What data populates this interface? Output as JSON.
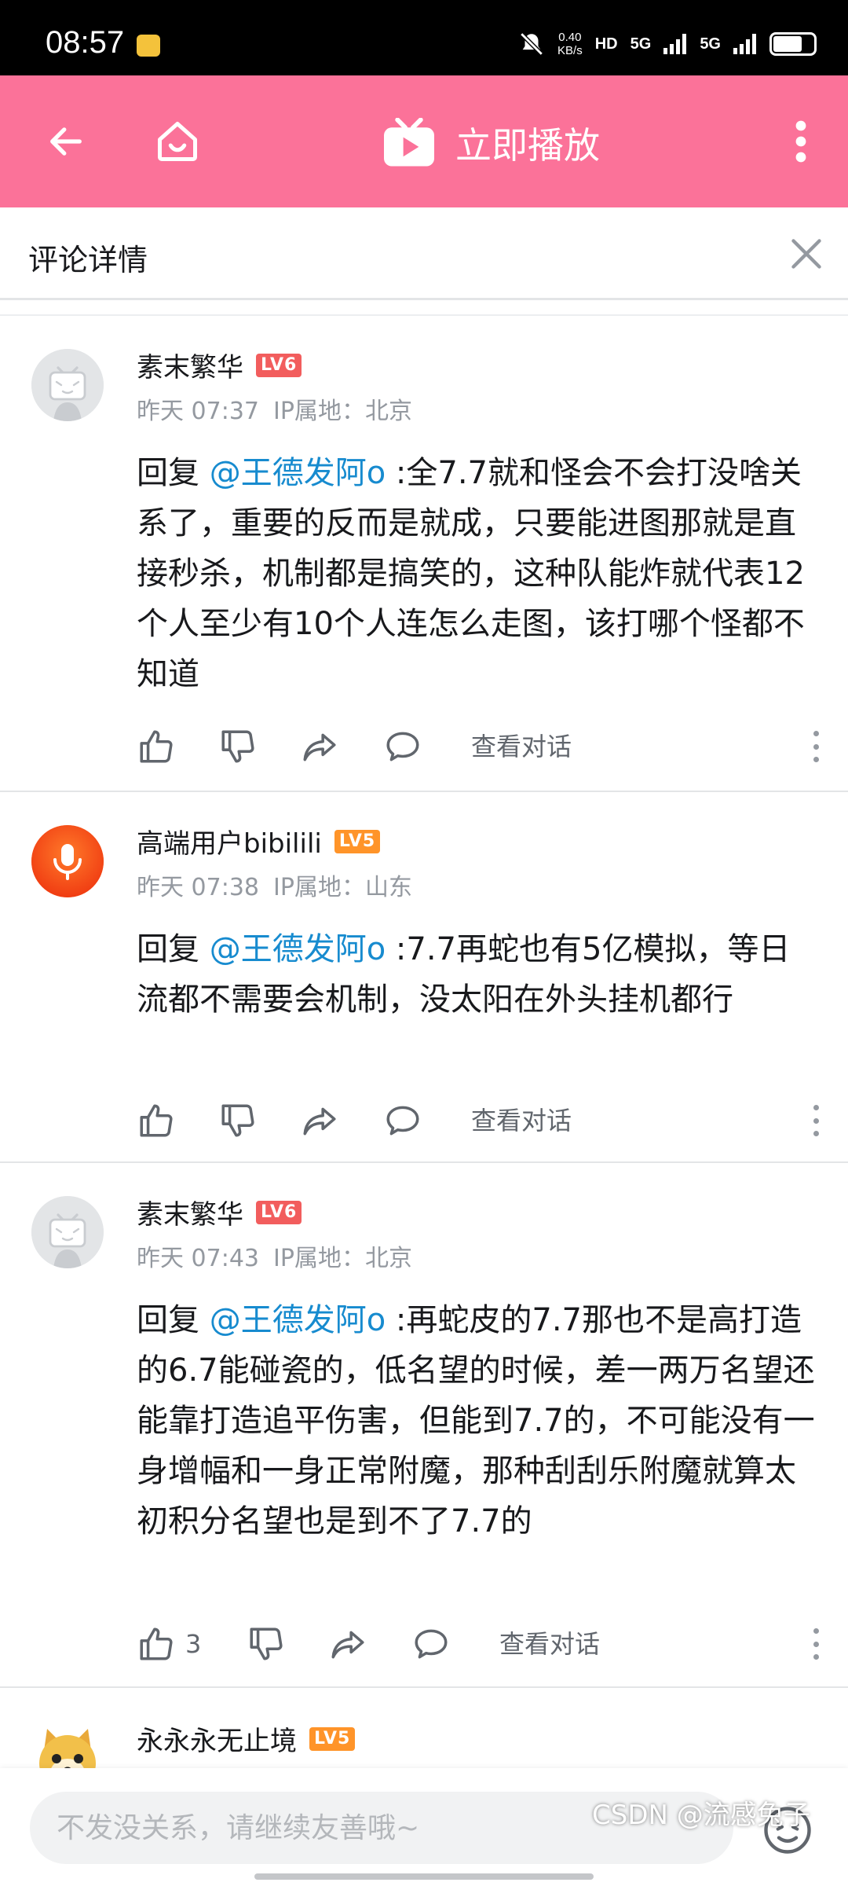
{
  "status_bar": {
    "time": "08:57",
    "net_speed_value": "0.40",
    "net_speed_unit": "KB/s",
    "hd_label": "HD",
    "signal1": "5G",
    "signal2": "5G",
    "battery_level": 0.66
  },
  "header": {
    "play_label": "立即播放",
    "bg_color": "#fb7299"
  },
  "sub_header": {
    "title": "评论详情"
  },
  "comments": [
    {
      "username": "素末繁华",
      "level": "LV6",
      "time": "昨天 07:37",
      "ip": "IP属地：北京",
      "reply_prefix": "回复 ",
      "mention": "@王德发阿o",
      "text": " :全7.7就和怪会不会打没啥关系了，重要的反而是就成，只要能进图那就是直接秒杀，机制都是搞笑的，这种队能炸就代表12个人至少有10个人连怎么走图，该打哪个怪都不知道",
      "like_count": "",
      "view_thread": "查看对话"
    },
    {
      "username": "高端用户bibilili",
      "level": "LV5",
      "time": "昨天 07:38",
      "ip": "IP属地：山东",
      "reply_prefix": "回复 ",
      "mention": "@王德发阿o",
      "text": " :7.7再蛇也有5亿模拟，等日流都不需要会机制，没太阳在外头挂机都行",
      "like_count": "",
      "view_thread": "查看对话"
    },
    {
      "username": "素末繁华",
      "level": "LV6",
      "time": "昨天 07:43",
      "ip": "IP属地：北京",
      "reply_prefix": "回复 ",
      "mention": "@王德发阿o",
      "text": " :再蛇皮的7.7那也不是高打造的6.7能碰瓷的，低名望的时候，差一两万名望还能靠打造追平伤害，但能到7.7的，不可能没有一身增幅和一身正常附魔，那种刮刮乐附魔就算太初积分名望也是到不了7.7的",
      "like_count": "3",
      "view_thread": "查看对话"
    },
    {
      "username": "永永永无止境",
      "level": "LV5"
    }
  ],
  "bottom": {
    "input_placeholder": "不发没关系，请继续友善哦~",
    "watermark": "CSDN @流感兔子"
  }
}
